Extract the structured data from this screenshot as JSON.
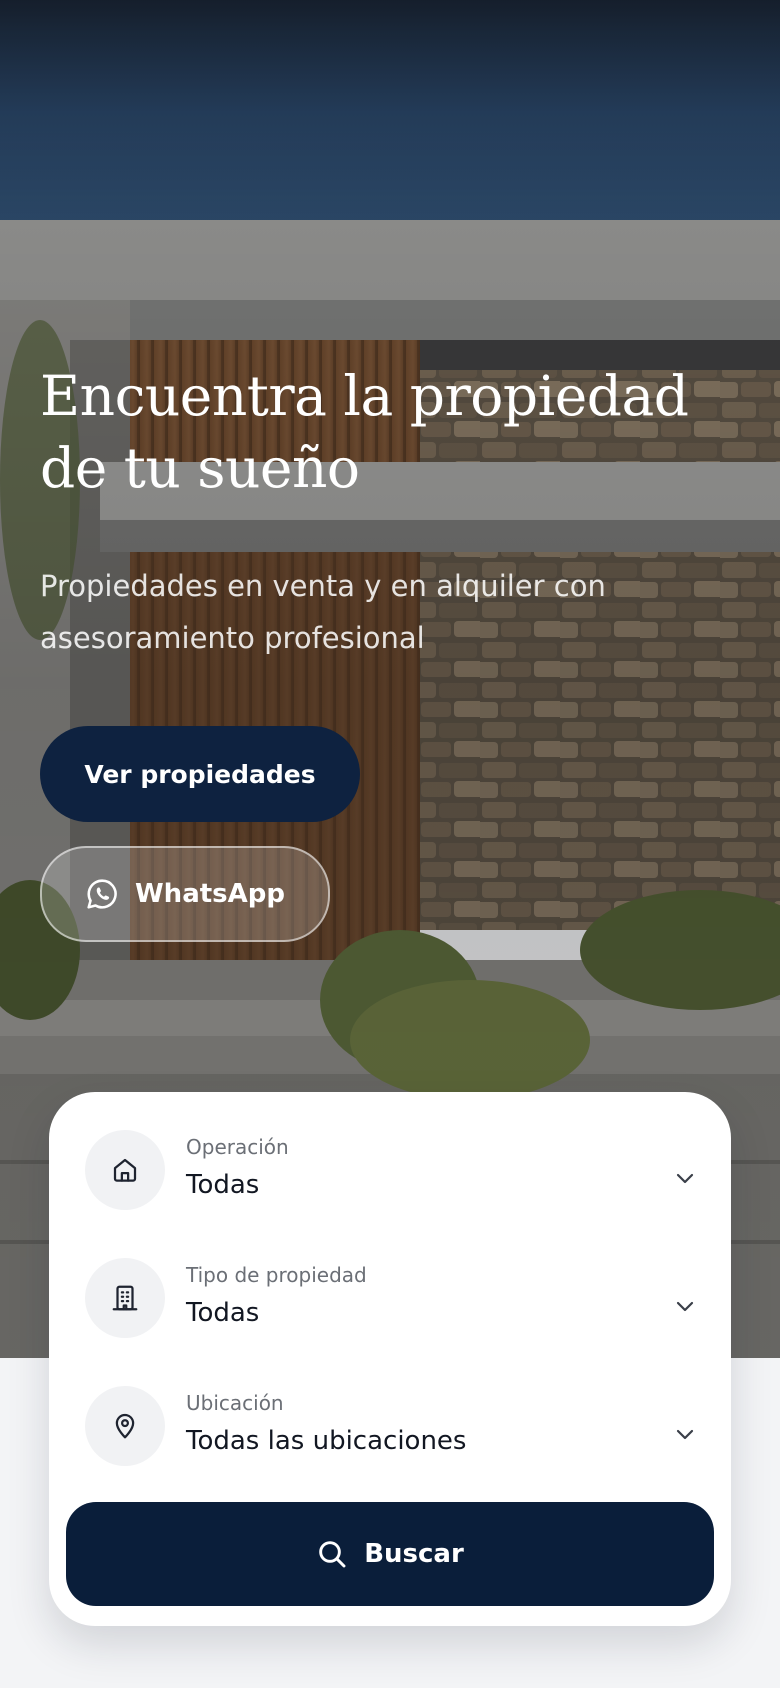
{
  "hero": {
    "title": "Encuentra la propiedad de tu sueño",
    "subtitle": "Propiedades en venta y en alquiler con asesoramiento profesional",
    "primary_button": "Ver propiedades",
    "whatsapp_button": "WhatsApp"
  },
  "search": {
    "fields": [
      {
        "label": "Operación",
        "value": "Todas",
        "icon": "home-icon"
      },
      {
        "label": "Tipo de propiedad",
        "value": "Todas",
        "icon": "building-icon"
      },
      {
        "label": "Ubicación",
        "value": "Todas las ubicaciones",
        "icon": "map-pin-icon"
      }
    ],
    "button": "Buscar"
  },
  "colors": {
    "primary": "#0e2240",
    "search_button": "#0a1e3a",
    "card": "#ffffff",
    "icon_circle": "#f1f2f4",
    "page_background": "#f3f4f6"
  }
}
